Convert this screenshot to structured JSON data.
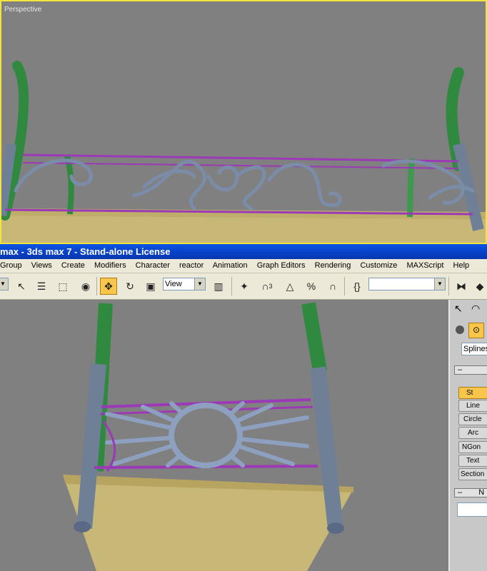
{
  "viewport_top": {
    "label": "Perspective"
  },
  "window": {
    "title": "max - 3ds max 7  - Stand-alone License"
  },
  "menu": {
    "items": [
      "Group",
      "Views",
      "Create",
      "Modifiers",
      "Character",
      "reactor",
      "Animation",
      "Graph Editors",
      "Rendering",
      "Customize",
      "MAXScript",
      "Help"
    ]
  },
  "toolbar": {
    "ref_coord": "View",
    "snap_3": "3",
    "named_sel_placeholder": "",
    "icons": [
      "select-icon",
      "select-by-name-icon",
      "region-select-icon",
      "window-crossing-icon",
      "move-icon",
      "rotate-icon",
      "scale-icon",
      "pivot-icon",
      "manipulate-icon",
      "snap-icon",
      "angle-snap-icon",
      "percent-snap-icon",
      "spinner-snap-icon",
      "edit-named-selection-icon",
      "mirror-icon",
      "align-icon"
    ]
  },
  "command_panel": {
    "category": "Splines",
    "rollout_object_type": "–",
    "buttons": [
      "St",
      "Line",
      "Circle",
      "Arc",
      "NGon",
      "Text",
      "Section"
    ],
    "rollout_name": "N"
  },
  "colors": {
    "selection": "#f2e43a",
    "title_bar": "#0a55e6",
    "rail": "#9b39b6",
    "metal": "#7a8ca8",
    "pole_top": "#2f8a3f",
    "floor": "#c8b878"
  }
}
